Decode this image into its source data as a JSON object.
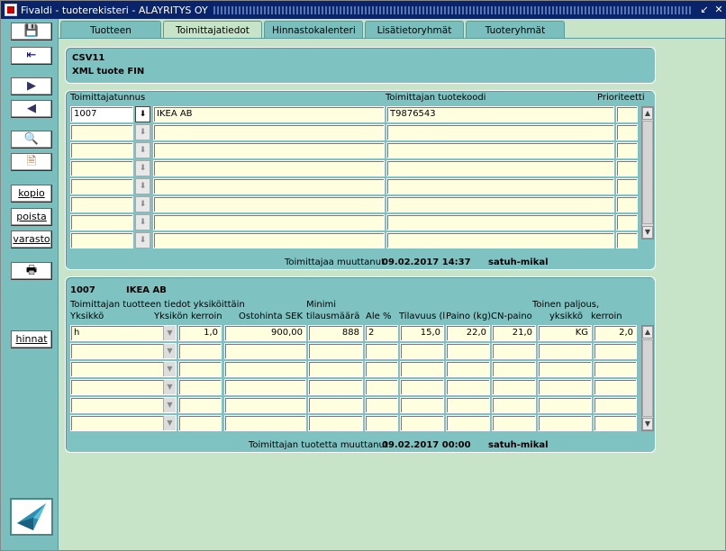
{
  "window": {
    "title": "Fivaldi - tuoterekisteri - ALAYRITYS OY",
    "controls": [
      "↙",
      "✕"
    ]
  },
  "sidebar": {
    "kopio": "kopio",
    "poista": "poista",
    "varasto": "varasto",
    "hinnat": "hinnat"
  },
  "tabs": [
    {
      "label": "Tuotteen perustiedot"
    },
    {
      "label": "Toimittajatiedot"
    },
    {
      "label": "Hinnastokalenteri"
    },
    {
      "label": "Lisätietoryhmät"
    },
    {
      "label": "Tuoteryhmät"
    }
  ],
  "product": {
    "code": "CSV11",
    "name": "XML tuote FIN"
  },
  "suppliers": {
    "headers": {
      "id": "Toimittajatunnus",
      "code": "Toimittajan tuotekoodi",
      "priority": "Prioriteetti"
    },
    "rows": [
      {
        "id": "1007",
        "name": "IKEA AB",
        "code": "T9876543",
        "priority": ""
      }
    ],
    "changed_label": "Toimittajaa muuttanut",
    "changed_date": "09.02.2017 14:37",
    "changed_user": "satuh-mikal"
  },
  "supplier_units": {
    "supplier_id": "1007",
    "supplier_name": "IKEA AB",
    "headers": {
      "group": "Toimittajan tuotteen tiedot yksiköittäin",
      "unit": "Yksikkö",
      "unit_factor": "Yksikön kerroin",
      "price": "Ostohinta SEK",
      "min_qty_1": "Minimi",
      "min_qty_2": "tilausmäärä",
      "discount": "Ale %",
      "volume": "Tilavuus (l)",
      "weight": "Paino (kg)",
      "cn_weight": "CN-paino",
      "other_qty": "Toinen paljous,",
      "other_unit": "yksikkö",
      "other_factor": "kerroin"
    },
    "rows": [
      {
        "unit": "h",
        "unit_factor": "1,0",
        "price": "900,00",
        "min_qty": "888",
        "discount": "2",
        "volume": "15,0",
        "weight": "22,0",
        "cn_weight": "21,0",
        "other_unit": "KG",
        "other_factor": "2,0"
      }
    ],
    "changed_label": "Toimittajan tuotetta muuttanut",
    "changed_date": "09.02.2017 00:00",
    "changed_user": "satuh-mikal"
  }
}
